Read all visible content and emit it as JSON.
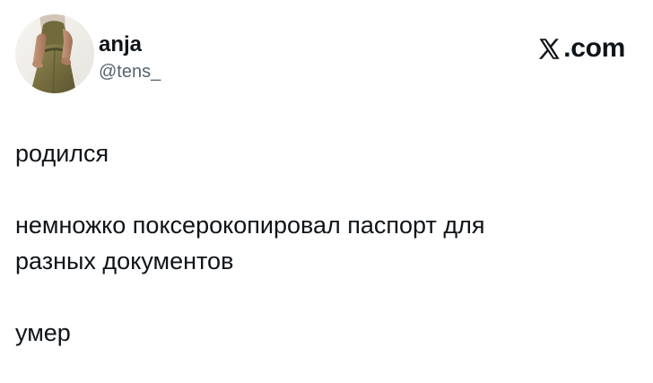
{
  "post": {
    "author": {
      "display_name": "anja",
      "handle": "@tens_",
      "avatar": "profile-photo"
    },
    "brand": {
      "icon": "x-logo-icon",
      "text": ".com"
    },
    "text": {
      "paragraph_1": "родился",
      "paragraph_2_line_1": "немножко поксерокопировал паспорт для",
      "paragraph_2_line_2": "разных документов",
      "paragraph_3": "умер"
    }
  },
  "colors": {
    "text_primary": "#0f1419",
    "text_secondary": "#536471",
    "background": "#ffffff"
  }
}
